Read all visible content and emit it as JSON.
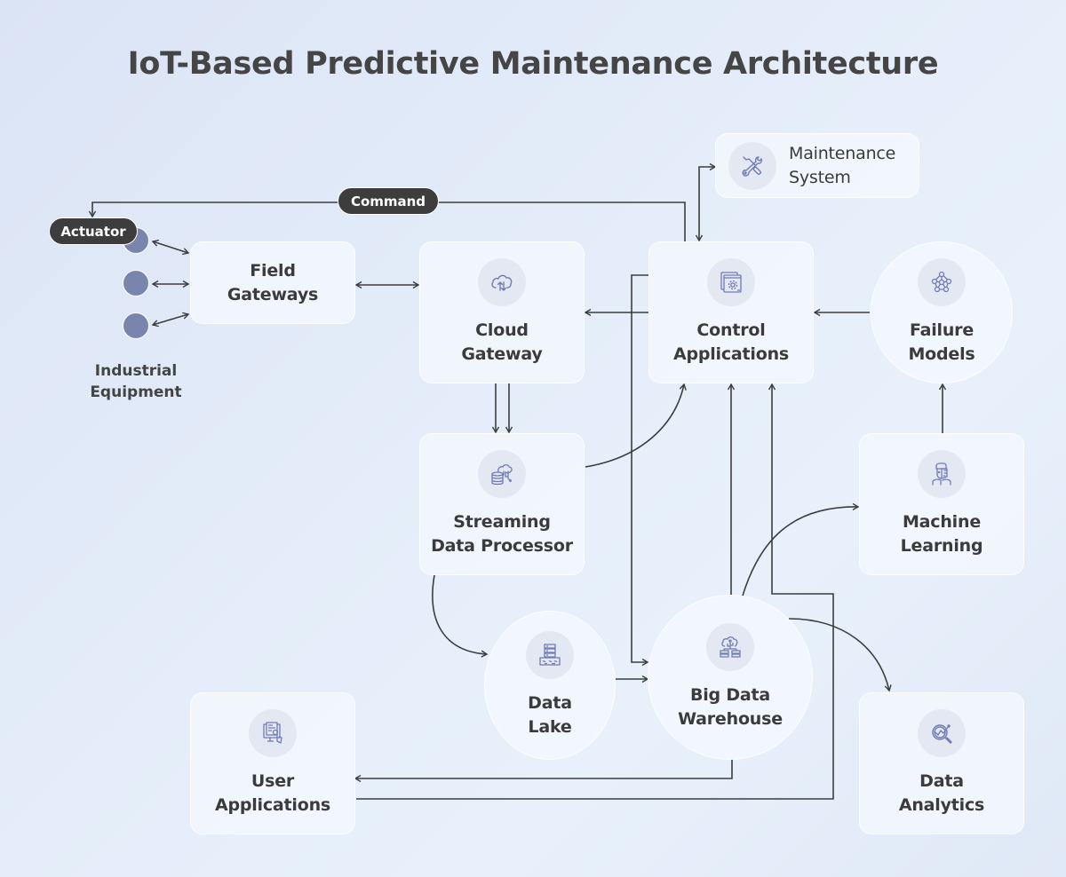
{
  "title": "IoT-Based Predictive Maintenance Architecture",
  "colors": {
    "icon_stroke": "#6f7cb5",
    "icon_bg": "#e3e8f3",
    "equipment_fill": "#7a85ae",
    "pill_bg": "#3d3d3d",
    "connector": "#3d3d3d"
  },
  "equipment": {
    "label": "Industrial\nEquipment",
    "count": 3
  },
  "pills": {
    "actuator": "Actuator",
    "command": "Command"
  },
  "nodes": {
    "field_gateways": {
      "label": "Field\nGateways",
      "icon": null
    },
    "cloud_gateway": {
      "label": "Cloud\nGateway",
      "icon": "cloud-upload-download-icon"
    },
    "control_applications": {
      "label": "Control\nApplications",
      "icon": "window-gear-icon"
    },
    "maintenance_system": {
      "label": "Maintenance\nSystem",
      "icon": "wrench-screwdriver-icon"
    },
    "failure_models": {
      "label": "Failure\nModels",
      "icon": "network-nodes-icon"
    },
    "streaming_data_processor": {
      "label": "Streaming\nData Processor",
      "icon": "database-brain-icon"
    },
    "machine_learning": {
      "label": "Machine\nLearning",
      "icon": "robot-human-icon"
    },
    "data_lake": {
      "label": "Data\nLake",
      "icon": "server-lake-icon"
    },
    "big_data_warehouse": {
      "label": "Big Data\nWarehouse",
      "icon": "cloud-servers-icon"
    },
    "user_applications": {
      "label": "User\nApplications",
      "icon": "monitor-document-icon"
    },
    "data_analytics": {
      "label": "Data\nAnalytics",
      "icon": "magnifier-chart-icon"
    }
  },
  "connections": [
    {
      "from": "industrial_equipment",
      "to": "field_gateways",
      "type": "bidirectional"
    },
    {
      "from": "field_gateways",
      "to": "cloud_gateway",
      "type": "bidirectional"
    },
    {
      "from": "control_applications",
      "to": "cloud_gateway"
    },
    {
      "from": "control_applications",
      "to": "actuator",
      "label": "Command"
    },
    {
      "from": "control_applications",
      "to": "maintenance_system",
      "type": "bidirectional"
    },
    {
      "from": "failure_models",
      "to": "control_applications"
    },
    {
      "from": "cloud_gateway",
      "to": "streaming_data_processor"
    },
    {
      "from": "streaming_data_processor",
      "to": "control_applications"
    },
    {
      "from": "streaming_data_processor",
      "to": "data_lake"
    },
    {
      "from": "data_lake",
      "to": "big_data_warehouse"
    },
    {
      "from": "control_applications",
      "to": "big_data_warehouse"
    },
    {
      "from": "big_data_warehouse",
      "to": "control_applications"
    },
    {
      "from": "big_data_warehouse",
      "to": "machine_learning"
    },
    {
      "from": "machine_learning",
      "to": "failure_models"
    },
    {
      "from": "big_data_warehouse",
      "to": "data_analytics"
    },
    {
      "from": "big_data_warehouse",
      "to": "user_applications"
    },
    {
      "from": "user_applications",
      "to": "control_applications"
    }
  ]
}
